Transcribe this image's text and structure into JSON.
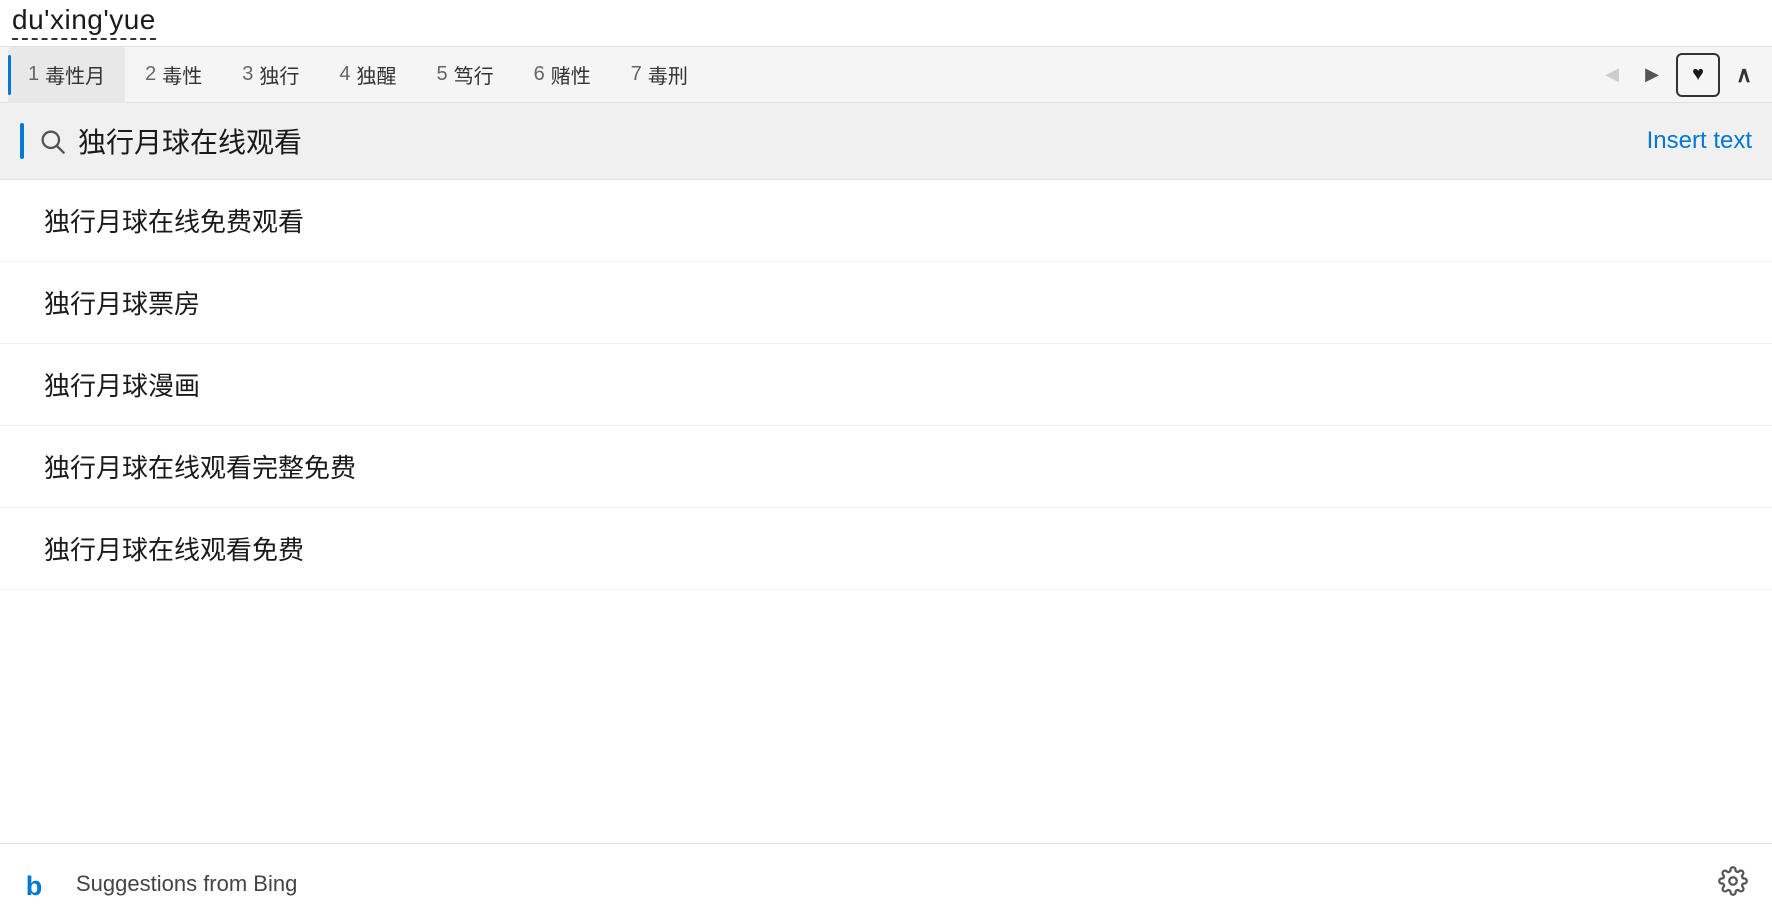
{
  "inputBar": {
    "text": "du'xing'yue"
  },
  "tabs": [
    {
      "id": 1,
      "label": "毒性月",
      "active": true
    },
    {
      "id": 2,
      "label": "毒性",
      "active": false
    },
    {
      "id": 3,
      "label": "独行",
      "active": false
    },
    {
      "id": 4,
      "label": "独醒",
      "active": false
    },
    {
      "id": 5,
      "label": "笃行",
      "active": false
    },
    {
      "id": 6,
      "label": "赌性",
      "active": false
    },
    {
      "id": 7,
      "label": "毒刑",
      "active": false
    }
  ],
  "searchBar": {
    "query": "独行月球在线观看",
    "insertTextLabel": "Insert text"
  },
  "suggestions": [
    {
      "text": "独行月球在线免费观看"
    },
    {
      "text": "独行月球票房"
    },
    {
      "text": "独行月球漫画"
    },
    {
      "text": "独行月球在线观看完整免费"
    },
    {
      "text": "独行月球在线观看免费"
    }
  ],
  "footer": {
    "label": "Suggestions from Bing"
  },
  "icons": {
    "search": "🔍",
    "heart": "♥",
    "settings": "⚙",
    "bingLogo": "b"
  }
}
